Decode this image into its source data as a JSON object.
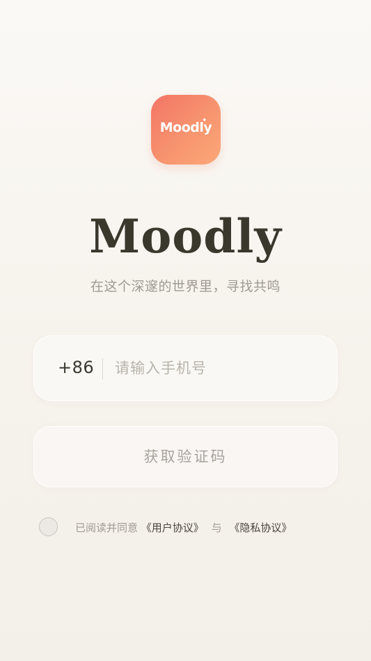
{
  "app": {
    "icon_text": "Moodly",
    "icon_sparkle": "✦",
    "title": "Moodly",
    "subtitle": "在这个深邃的世界里，寻找共鸣"
  },
  "login": {
    "country_code": "+86",
    "phone_placeholder": "请输入手机号",
    "phone_value": "",
    "get_code_label": "获取验证码"
  },
  "agreement": {
    "checked": false,
    "prefix": "已阅读并同意",
    "user_agreement_link": "《用户协议》",
    "conjunction": "与",
    "privacy_link": "《隐私协议》"
  },
  "colors": {
    "brand_gradient_start": "#f27566",
    "brand_gradient_end": "#fba878",
    "title_color": "#3a372d",
    "muted_text": "#a09b94",
    "background": "#f6f2ec"
  }
}
